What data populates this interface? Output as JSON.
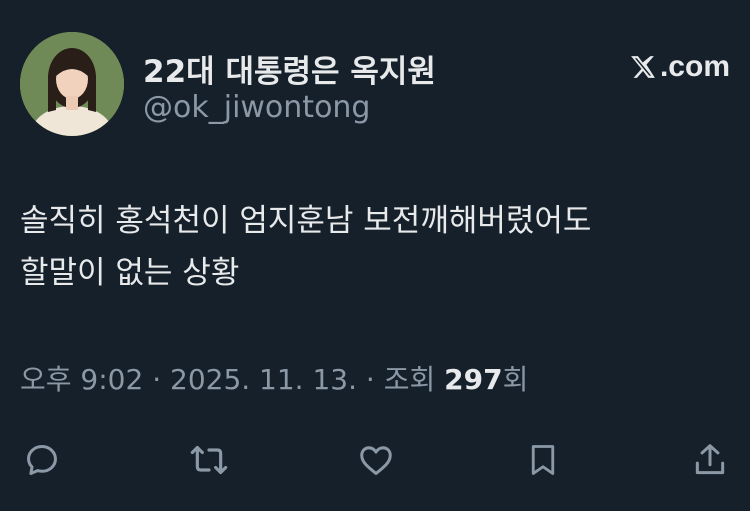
{
  "author": {
    "display_name": "22대 대통령은 옥지원",
    "handle": "@ok_jiwontong"
  },
  "brand": {
    "label": ".com",
    "icon": "x-logo-icon"
  },
  "tweet": {
    "text": "솔직히 홍석천이 엄지훈남 보전깨해버렸어도\n할말이 없는 상황"
  },
  "meta": {
    "time_date": "오후 9:02 · 2025. 11. 13. · 조회 ",
    "view_count": "297",
    "view_suffix": "회"
  },
  "actions": [
    {
      "icon": "reply-icon"
    },
    {
      "icon": "retweet-icon"
    },
    {
      "icon": "like-icon"
    },
    {
      "icon": "bookmark-icon"
    },
    {
      "icon": "share-icon"
    }
  ],
  "colors": {
    "background": "#15202b",
    "text_primary": "#e7e9ea",
    "text_secondary": "#8b98a5"
  }
}
